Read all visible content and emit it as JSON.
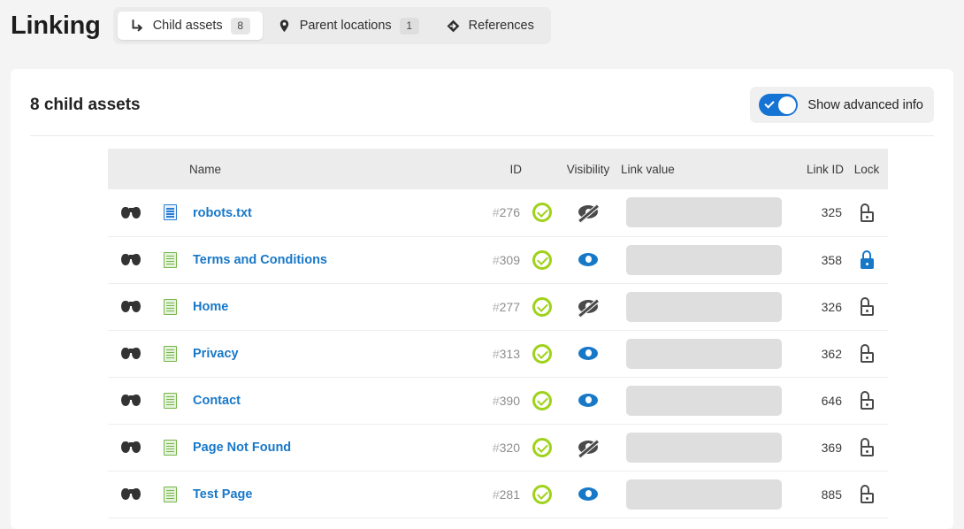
{
  "header": {
    "title": "Linking",
    "tabs": [
      {
        "label": "Child assets",
        "badge": "8",
        "icon": "arrow-turn-down-right-icon",
        "active": true
      },
      {
        "label": "Parent locations",
        "badge": "1",
        "icon": "map-pin-icon",
        "active": false
      },
      {
        "label": "References",
        "badge": null,
        "icon": "references-diamond-icon",
        "active": false
      }
    ]
  },
  "card": {
    "title": "8 child assets",
    "advanced_toggle": {
      "label": "Show advanced info",
      "checked": true,
      "accent_color": "#1573d4"
    }
  },
  "table": {
    "columns": {
      "name": "Name",
      "id": "ID",
      "visibility": "Visibility",
      "link_value": "Link value",
      "link_id": "Link ID",
      "lock": "Lock"
    },
    "rows": [
      {
        "preview_icon": "binoculars-icon",
        "file_icon": "txt-file-icon",
        "name": "robots.txt",
        "id": "#276",
        "status": "approved",
        "visibility": "hidden",
        "link_value": "",
        "link_id": "325",
        "lock": "unlocked"
      },
      {
        "preview_icon": "binoculars-icon",
        "file_icon": "page-file-icon",
        "name": "Terms and Conditions",
        "id": "#309",
        "status": "approved",
        "visibility": "visible",
        "link_value": "",
        "link_id": "358",
        "lock": "locked"
      },
      {
        "preview_icon": "binoculars-icon",
        "file_icon": "page-file-icon",
        "name": "Home",
        "id": "#277",
        "status": "approved",
        "visibility": "hidden",
        "link_value": "",
        "link_id": "326",
        "lock": "unlocked"
      },
      {
        "preview_icon": "binoculars-icon",
        "file_icon": "page-file-icon",
        "name": "Privacy",
        "id": "#313",
        "status": "approved",
        "visibility": "visible",
        "link_value": "",
        "link_id": "362",
        "lock": "unlocked"
      },
      {
        "preview_icon": "binoculars-icon",
        "file_icon": "page-file-icon",
        "name": "Contact",
        "id": "#390",
        "status": "approved",
        "visibility": "visible",
        "link_value": "",
        "link_id": "646",
        "lock": "unlocked"
      },
      {
        "preview_icon": "binoculars-icon",
        "file_icon": "page-file-icon",
        "name": "Page Not Found",
        "id": "#320",
        "status": "approved",
        "visibility": "hidden",
        "link_value": "",
        "link_id": "369",
        "lock": "unlocked"
      },
      {
        "preview_icon": "binoculars-icon",
        "file_icon": "page-file-icon",
        "name": "Test Page",
        "id": "#281",
        "status": "approved",
        "visibility": "visible",
        "link_value": "",
        "link_id": "885",
        "lock": "unlocked"
      }
    ]
  },
  "colors": {
    "link": "#1878c8",
    "status_green": "#9fd21a",
    "page_bg": "#f4f4f4"
  }
}
